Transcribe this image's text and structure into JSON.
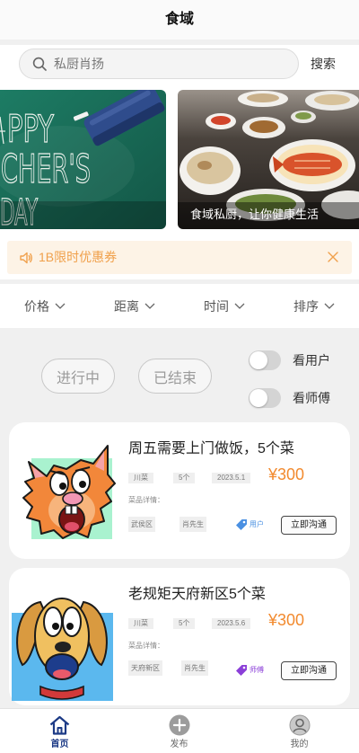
{
  "header": {
    "title": "食域"
  },
  "search": {
    "placeholder": "私厨肖扬",
    "button_label": "搜索",
    "icon": "search-icon"
  },
  "banner": {
    "slides": [
      {
        "chalk_lines": [
          "PPY",
          "CHER'S",
          "DAY"
        ]
      },
      {
        "caption": "食域私厨，让你健康生活"
      }
    ]
  },
  "notice": {
    "icon": "speaker-icon",
    "text": "1B限时优惠券",
    "close_icon": "close-icon"
  },
  "filters": [
    {
      "label": "价格",
      "icon": "chevron-down-icon"
    },
    {
      "label": "距离",
      "icon": "chevron-down-icon"
    },
    {
      "label": "时间",
      "icon": "chevron-down-icon"
    },
    {
      "label": "排序",
      "icon": "chevron-down-icon"
    }
  ],
  "status_tabs": [
    {
      "label": "进行中"
    },
    {
      "label": "已结束"
    }
  ],
  "toggles": [
    {
      "label": "看用户",
      "checked": false
    },
    {
      "label": "看师傅",
      "checked": false
    }
  ],
  "orders": [
    {
      "avatar": "cartoon-squirrel",
      "title": "周五需要上门做饭，5个菜",
      "tags": [
        "川菜",
        "5个",
        "2023.5.1"
      ],
      "price": "¥300",
      "details_label": "菜品详情：",
      "district": "武侯区",
      "contact": "肖先生",
      "role_icon": "tag-icon",
      "role": "用户",
      "role_color": "#4a90e2",
      "action_label": "立即沟通"
    },
    {
      "avatar": "cartoon-dog",
      "title": "老规矩天府新区5个菜",
      "tags": [
        "川菜",
        "5个",
        "2023.5.6"
      ],
      "price": "¥300",
      "details_label": "菜品详情：",
      "district": "天府新区",
      "contact": "肖先生",
      "role_icon": "tag-icon",
      "role": "师傅",
      "role_color": "#8b3fd8",
      "action_label": "立即沟通"
    }
  ],
  "tabbar": [
    {
      "label": "首页",
      "icon": "home-icon",
      "active": true
    },
    {
      "label": "发布",
      "icon": "plus-circle-icon",
      "active": false
    },
    {
      "label": "我的",
      "icon": "user-icon",
      "active": false
    }
  ],
  "colors": {
    "price": "#f28a2e",
    "notice_text": "#f0a04b",
    "notice_bg": "#fdf3e6",
    "active_tab": "#1c3a86",
    "page_bg": "#f0f0f0"
  }
}
